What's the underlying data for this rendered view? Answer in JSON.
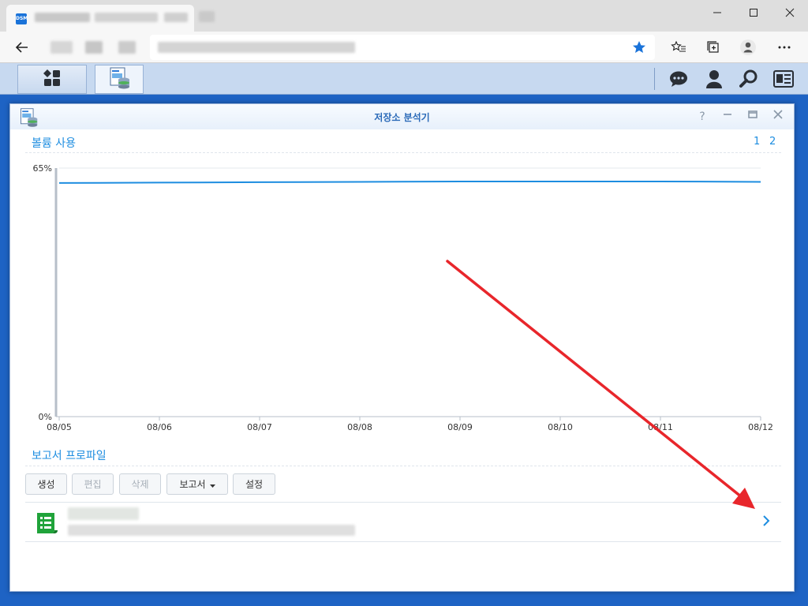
{
  "browser": {
    "favicon_text": "DSM",
    "back_icon": "arrow-left-icon",
    "favorite_icon": "star-icon",
    "favorites_list_icon": "favorites-list-icon",
    "collections_icon": "collections-icon",
    "profile_icon": "profile-icon",
    "menu_icon": "more-icon",
    "accent": "#1a73d9"
  },
  "dsm_taskbar": {
    "main_menu_icon": "main-menu-icon",
    "storage_analyzer_icon": "storage-analyzer-icon",
    "chat_icon": "chat-icon",
    "user_icon": "user-icon",
    "search_icon": "search-icon",
    "widgets_icon": "widgets-icon"
  },
  "window": {
    "title": "저장소 분석기",
    "help": "?",
    "app_icon": "storage-analyzer-icon"
  },
  "volume_section": {
    "title": "볼륨 사용",
    "pages": [
      "1",
      "2"
    ]
  },
  "chart_data": {
    "type": "line",
    "x": [
      "08/05",
      "08/06",
      "08/07",
      "08/08",
      "08/09",
      "08/10",
      "08/11",
      "08/12"
    ],
    "series": [
      {
        "values": [
          61.1,
          61.2,
          61.3,
          61.4,
          61.5,
          61.5,
          61.5,
          61.4
        ]
      }
    ],
    "ylim": [
      0,
      65
    ],
    "yticks": [
      "0%",
      "65%"
    ],
    "line_color": "#1d8de0"
  },
  "report_section": {
    "title": "보고서 프로파일",
    "buttons": {
      "create": "생성",
      "edit": "편집",
      "delete": "삭제",
      "report": "보고서",
      "settings": "설정"
    },
    "item_icon": "report-profile-icon"
  },
  "annotation": {
    "arrow_color": "#e8262b"
  }
}
